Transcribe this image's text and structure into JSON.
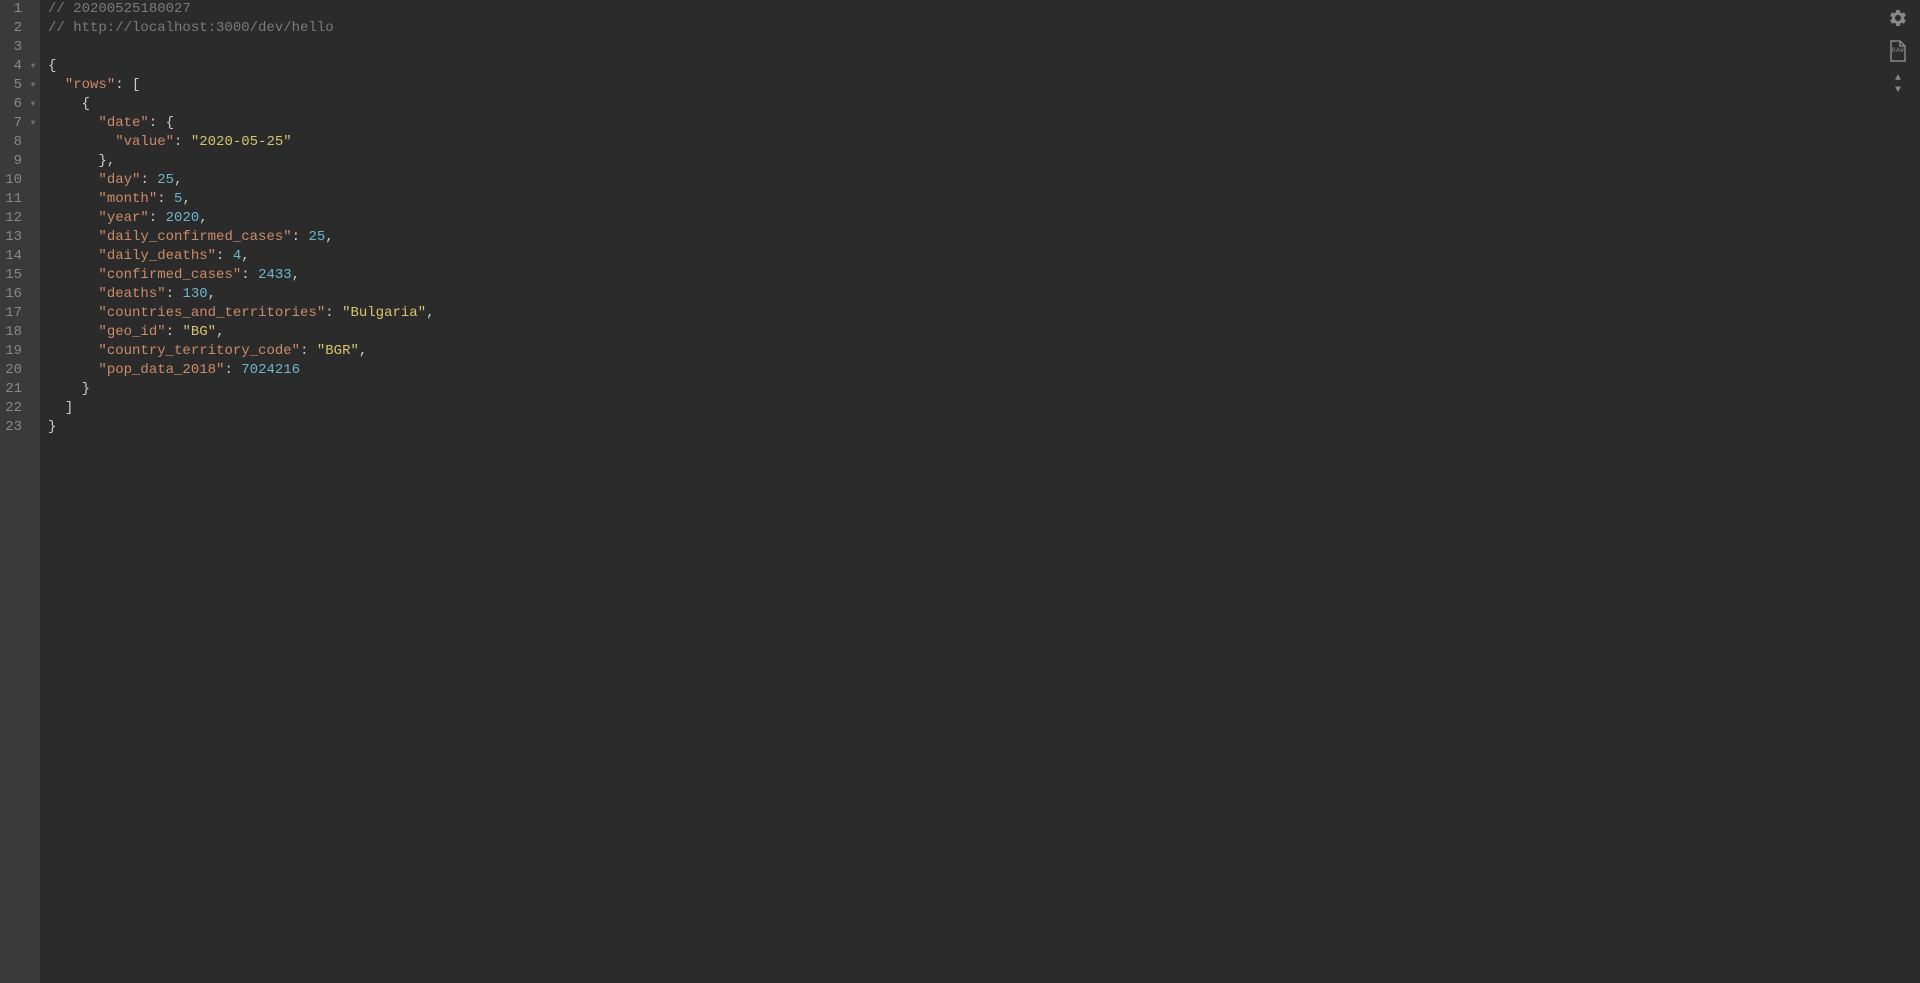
{
  "lines": [
    {
      "num": 1,
      "fold": "",
      "tokens": [
        {
          "cls": "comment",
          "text": "// 20200525180027"
        }
      ]
    },
    {
      "num": 2,
      "fold": "",
      "tokens": [
        {
          "cls": "comment",
          "text": "// http://localhost:3000/dev/hello"
        }
      ]
    },
    {
      "num": 3,
      "fold": "",
      "tokens": []
    },
    {
      "num": 4,
      "fold": "▼",
      "tokens": [
        {
          "cls": "brace",
          "text": "{"
        }
      ]
    },
    {
      "num": 5,
      "fold": "▼",
      "tokens": [
        {
          "cls": "",
          "text": "  "
        },
        {
          "cls": "key",
          "text": "\"rows\""
        },
        {
          "cls": "punct",
          "text": ": ["
        }
      ]
    },
    {
      "num": 6,
      "fold": "▼",
      "tokens": [
        {
          "cls": "",
          "text": "    "
        },
        {
          "cls": "brace",
          "text": "{"
        }
      ]
    },
    {
      "num": 7,
      "fold": "▼",
      "tokens": [
        {
          "cls": "",
          "text": "      "
        },
        {
          "cls": "key",
          "text": "\"date\""
        },
        {
          "cls": "punct",
          "text": ": "
        },
        {
          "cls": "brace",
          "text": "{"
        }
      ]
    },
    {
      "num": 8,
      "fold": "",
      "tokens": [
        {
          "cls": "",
          "text": "        "
        },
        {
          "cls": "key",
          "text": "\"value\""
        },
        {
          "cls": "punct",
          "text": ": "
        },
        {
          "cls": "string",
          "text": "\"2020-05-25\""
        }
      ]
    },
    {
      "num": 9,
      "fold": "",
      "tokens": [
        {
          "cls": "",
          "text": "      "
        },
        {
          "cls": "brace",
          "text": "}"
        },
        {
          "cls": "punct",
          "text": ","
        }
      ]
    },
    {
      "num": 10,
      "fold": "",
      "tokens": [
        {
          "cls": "",
          "text": "      "
        },
        {
          "cls": "key",
          "text": "\"day\""
        },
        {
          "cls": "punct",
          "text": ": "
        },
        {
          "cls": "number",
          "text": "25"
        },
        {
          "cls": "punct",
          "text": ","
        }
      ]
    },
    {
      "num": 11,
      "fold": "",
      "tokens": [
        {
          "cls": "",
          "text": "      "
        },
        {
          "cls": "key",
          "text": "\"month\""
        },
        {
          "cls": "punct",
          "text": ": "
        },
        {
          "cls": "number",
          "text": "5"
        },
        {
          "cls": "punct",
          "text": ","
        }
      ]
    },
    {
      "num": 12,
      "fold": "",
      "tokens": [
        {
          "cls": "",
          "text": "      "
        },
        {
          "cls": "key",
          "text": "\"year\""
        },
        {
          "cls": "punct",
          "text": ": "
        },
        {
          "cls": "number",
          "text": "2020"
        },
        {
          "cls": "punct",
          "text": ","
        }
      ]
    },
    {
      "num": 13,
      "fold": "",
      "tokens": [
        {
          "cls": "",
          "text": "      "
        },
        {
          "cls": "key",
          "text": "\"daily_confirmed_cases\""
        },
        {
          "cls": "punct",
          "text": ": "
        },
        {
          "cls": "number",
          "text": "25"
        },
        {
          "cls": "punct",
          "text": ","
        }
      ]
    },
    {
      "num": 14,
      "fold": "",
      "tokens": [
        {
          "cls": "",
          "text": "      "
        },
        {
          "cls": "key",
          "text": "\"daily_deaths\""
        },
        {
          "cls": "punct",
          "text": ": "
        },
        {
          "cls": "number",
          "text": "4"
        },
        {
          "cls": "punct",
          "text": ","
        }
      ]
    },
    {
      "num": 15,
      "fold": "",
      "tokens": [
        {
          "cls": "",
          "text": "      "
        },
        {
          "cls": "key",
          "text": "\"confirmed_cases\""
        },
        {
          "cls": "punct",
          "text": ": "
        },
        {
          "cls": "number",
          "text": "2433"
        },
        {
          "cls": "punct",
          "text": ","
        }
      ]
    },
    {
      "num": 16,
      "fold": "",
      "tokens": [
        {
          "cls": "",
          "text": "      "
        },
        {
          "cls": "key",
          "text": "\"deaths\""
        },
        {
          "cls": "punct",
          "text": ": "
        },
        {
          "cls": "number",
          "text": "130"
        },
        {
          "cls": "punct",
          "text": ","
        }
      ]
    },
    {
      "num": 17,
      "fold": "",
      "tokens": [
        {
          "cls": "",
          "text": "      "
        },
        {
          "cls": "key",
          "text": "\"countries_and_territories\""
        },
        {
          "cls": "punct",
          "text": ": "
        },
        {
          "cls": "string",
          "text": "\"Bulgaria\""
        },
        {
          "cls": "punct",
          "text": ","
        }
      ]
    },
    {
      "num": 18,
      "fold": "",
      "tokens": [
        {
          "cls": "",
          "text": "      "
        },
        {
          "cls": "key",
          "text": "\"geo_id\""
        },
        {
          "cls": "punct",
          "text": ": "
        },
        {
          "cls": "string",
          "text": "\"BG\""
        },
        {
          "cls": "punct",
          "text": ","
        }
      ]
    },
    {
      "num": 19,
      "fold": "",
      "tokens": [
        {
          "cls": "",
          "text": "      "
        },
        {
          "cls": "key",
          "text": "\"country_territory_code\""
        },
        {
          "cls": "punct",
          "text": ": "
        },
        {
          "cls": "string",
          "text": "\"BGR\""
        },
        {
          "cls": "punct",
          "text": ","
        }
      ]
    },
    {
      "num": 20,
      "fold": "",
      "tokens": [
        {
          "cls": "",
          "text": "      "
        },
        {
          "cls": "key",
          "text": "\"pop_data_2018\""
        },
        {
          "cls": "punct",
          "text": ": "
        },
        {
          "cls": "number",
          "text": "7024216"
        }
      ]
    },
    {
      "num": 21,
      "fold": "",
      "tokens": [
        {
          "cls": "",
          "text": "    "
        },
        {
          "cls": "brace",
          "text": "}"
        }
      ]
    },
    {
      "num": 22,
      "fold": "",
      "tokens": [
        {
          "cls": "",
          "text": "  "
        },
        {
          "cls": "punct",
          "text": "]"
        }
      ]
    },
    {
      "num": 23,
      "fold": "",
      "tokens": [
        {
          "cls": "brace",
          "text": "}"
        }
      ]
    }
  ],
  "toolbar": {
    "raw_label": "RAW"
  }
}
